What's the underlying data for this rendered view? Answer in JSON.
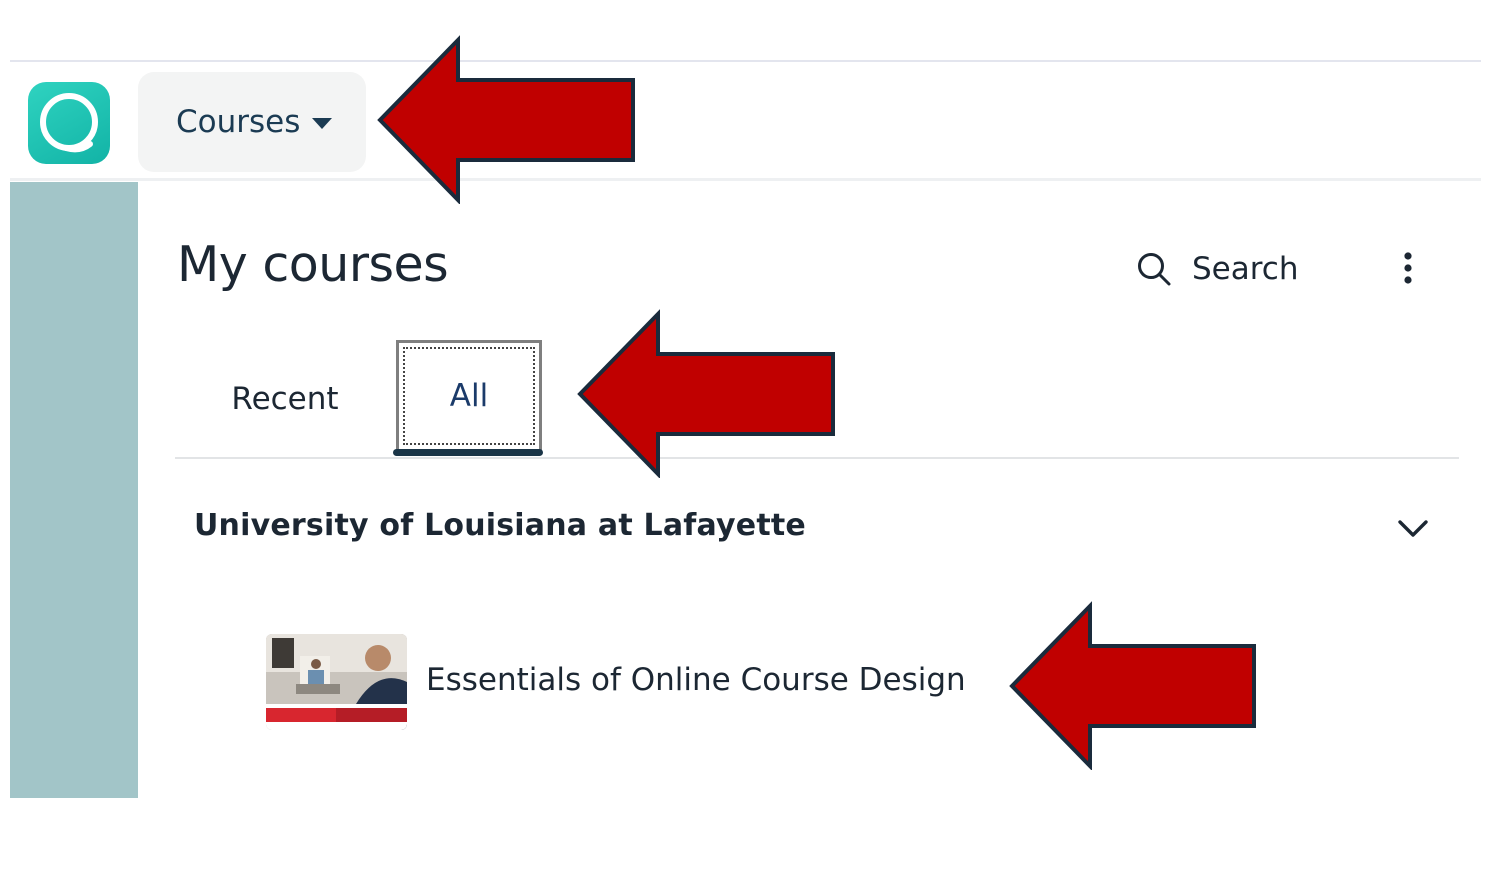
{
  "header": {
    "app_logo_icon": "chat-bubble-logo-icon",
    "courses_menu_label": "Courses"
  },
  "page": {
    "title": "My courses",
    "search_label": "Search"
  },
  "tabs": [
    {
      "label": "Recent",
      "selected": false
    },
    {
      "label": "All",
      "selected": true
    }
  ],
  "organizations": [
    {
      "name": "University of Louisiana at Lafayette",
      "expanded": true,
      "courses": [
        {
          "title": "Essentials of Online Course Design"
        }
      ]
    }
  ],
  "colors": {
    "accent": "#12b3a6",
    "annotation_arrow": "#c00000",
    "side_rail": "#a2c5c8"
  }
}
